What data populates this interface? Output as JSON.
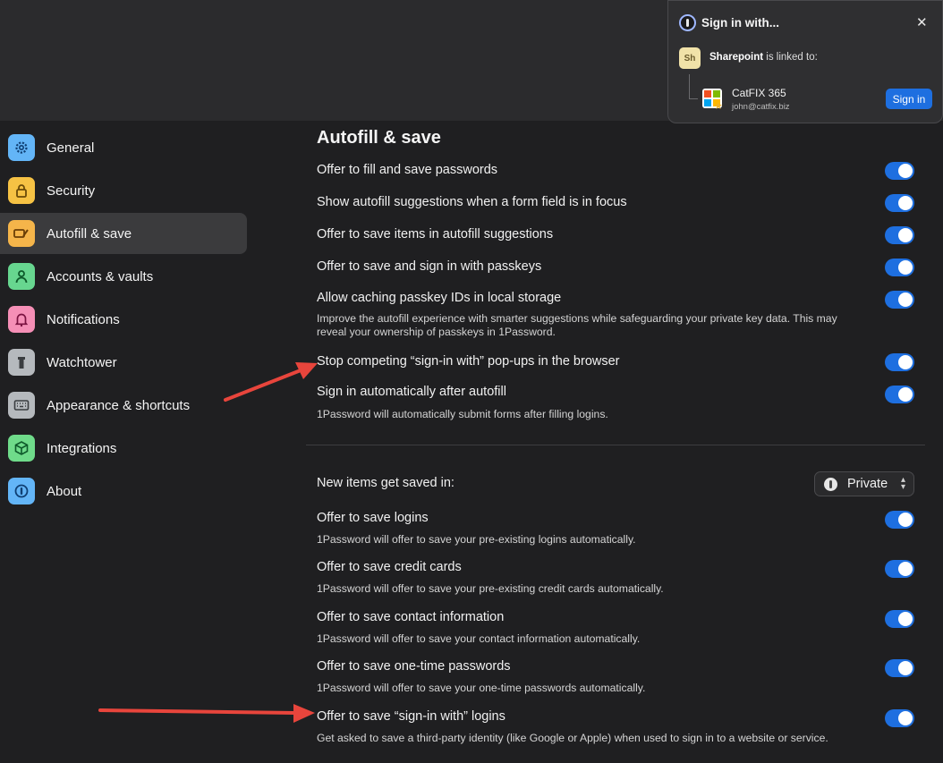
{
  "popup": {
    "title": "Sign in with...",
    "close_icon": "close-icon",
    "site_badge": "Sh",
    "site_name": "Sharepoint",
    "linked_text": " is linked to:",
    "account_name": "CatFIX 365",
    "account_email": "john@catfix.biz",
    "signin_label": "Sign in"
  },
  "sidebar": {
    "items": [
      {
        "label": "General",
        "icon": "gear-icon",
        "color": "#63b5f7",
        "active": false
      },
      {
        "label": "Security",
        "icon": "lock-icon",
        "color": "#f6c244",
        "active": false
      },
      {
        "label": "Autofill & save",
        "icon": "autofill-icon",
        "color": "#f5b54a",
        "active": true
      },
      {
        "label": "Accounts & vaults",
        "icon": "person-icon",
        "color": "#67d68f",
        "active": false
      },
      {
        "label": "Notifications",
        "icon": "bell-icon",
        "color": "#f58fb6",
        "active": false
      },
      {
        "label": "Watchtower",
        "icon": "tower-icon",
        "color": "#b5b9bd",
        "active": false
      },
      {
        "label": "Appearance & shortcuts",
        "icon": "keyboard-icon",
        "color": "#b5b9bd",
        "active": false
      },
      {
        "label": "Integrations",
        "icon": "box-icon",
        "color": "#6fdb8a",
        "active": false
      },
      {
        "label": "About",
        "icon": "onepassword-icon",
        "color": "#63b5f7",
        "active": false
      }
    ]
  },
  "main": {
    "title": "Autofill & save",
    "settings": [
      {
        "label": "Offer to fill and save passwords",
        "desc": "",
        "on": true
      },
      {
        "label": "Show autofill suggestions when a form field is in focus",
        "desc": "",
        "on": true
      },
      {
        "label": "Offer to save items in autofill suggestions",
        "desc": "",
        "on": true
      },
      {
        "label": "Offer to save and sign in with passkeys",
        "desc": "",
        "on": true
      },
      {
        "label": "Allow caching passkey IDs in local storage",
        "desc": "Improve the autofill experience with smarter suggestions while safeguarding your private key data. This may reveal your ownership of passkeys in 1Password.",
        "on": true
      },
      {
        "label": "Stop competing “sign-in with” pop-ups in the browser",
        "desc": "",
        "on": true
      },
      {
        "label": "Sign in automatically after autofill",
        "desc": "1Password will automatically submit forms after filling logins.",
        "on": true
      }
    ],
    "save_location_label": "New items get saved in:",
    "save_location_value": "Private",
    "save_settings": [
      {
        "label": "Offer to save logins",
        "desc": "1Password will offer to save your pre-existing logins automatically.",
        "on": true
      },
      {
        "label": "Offer to save credit cards",
        "desc": "1Password will offer to save your pre-existing credit cards automatically.",
        "on": true
      },
      {
        "label": "Offer to save contact information",
        "desc": "1Password will offer to save your contact information automatically.",
        "on": true
      },
      {
        "label": "Offer to save one-time passwords",
        "desc": "1Password will offer to save your one-time passwords automatically.",
        "on": true
      },
      {
        "label": "Offer to save “sign-in with” logins",
        "desc": "Get asked to save a third-party identity (like Google or Apple) when used to sign in to a website or service.",
        "on": true
      }
    ]
  },
  "colors": {
    "accent": "#1e6fe0",
    "annotation_arrow": "#e8453c"
  }
}
